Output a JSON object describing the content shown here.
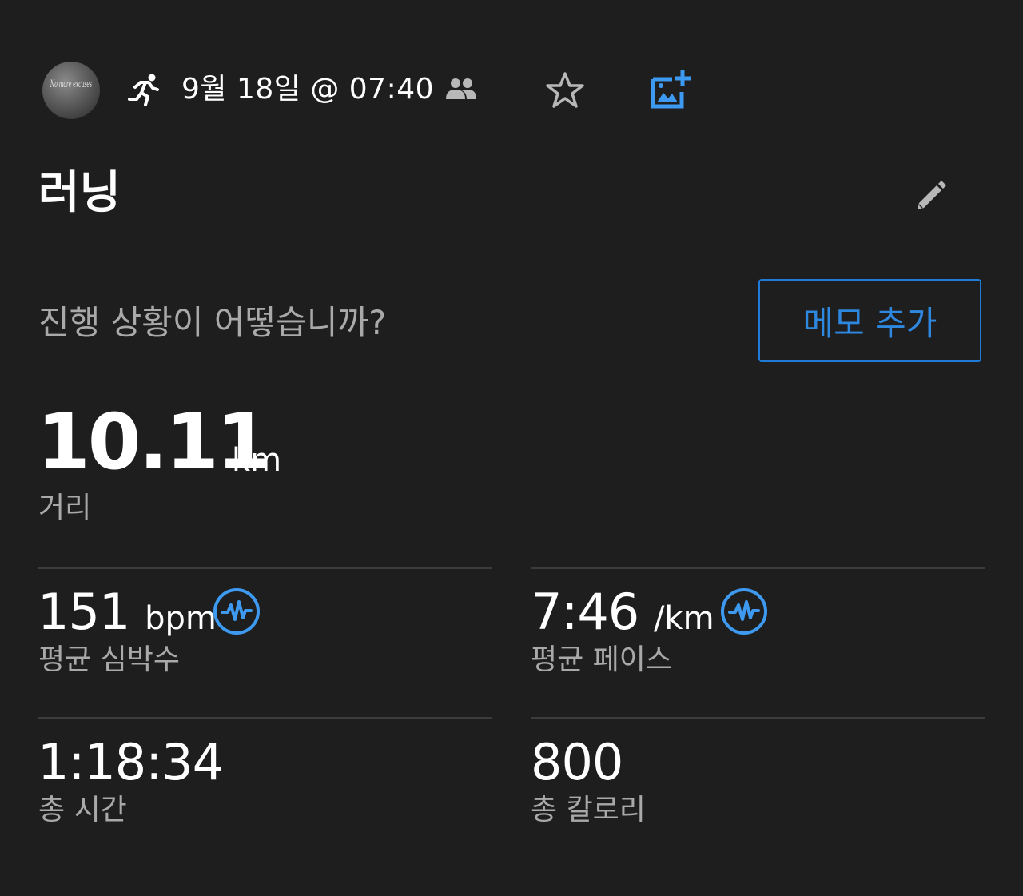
{
  "header": {
    "avatar_text": "No more excuses",
    "activity_icon": "running-icon",
    "date_time": "9월 18일 @ 07:40",
    "icons": [
      "group-icon",
      "star-icon",
      "add-photo-icon"
    ]
  },
  "activity": {
    "title": "러닝",
    "edit_icon": "pencil-icon"
  },
  "note": {
    "prompt": "진행 상황이 어떻습니까?",
    "button_label": "메모 추가"
  },
  "distance": {
    "value": "10.11",
    "unit": "km",
    "label": "거리"
  },
  "stats": [
    {
      "value": "151",
      "unit": "bpm",
      "label": "평균 심박수",
      "icon": "pulse-icon"
    },
    {
      "value": "7:46",
      "unit": "/km",
      "label": "평균 페이스",
      "icon": "pulse-icon"
    },
    {
      "value": "1:18:34",
      "unit": "",
      "label": "총 시간"
    },
    {
      "value": "800",
      "unit": "",
      "label": "총 칼로리"
    }
  ],
  "colors": {
    "background": "#1e1e1f",
    "accent": "#2f88e0",
    "secondary_text": "#a9a9a9",
    "divider": "#3c3c3d"
  }
}
